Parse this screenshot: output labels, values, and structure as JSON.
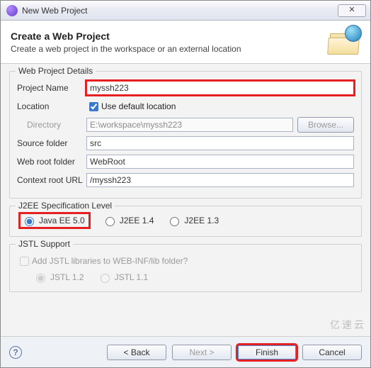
{
  "title": "New Web Project",
  "close": "✕",
  "header": {
    "heading": "Create a Web Project",
    "sub": "Create a web project in the workspace or an external location"
  },
  "details": {
    "group_title": "Web Project Details",
    "project_name_label": "Project Name",
    "project_name_value": "myssh223",
    "location_label": "Location",
    "use_default_label": "Use default location",
    "directory_label": "Directory",
    "directory_value": "E:\\workspace\\myssh223",
    "browse_label": "Browse...",
    "source_folder_label": "Source folder",
    "source_folder_value": "src",
    "web_root_label": "Web root folder",
    "web_root_value": "WebRoot",
    "context_root_label": "Context root URL",
    "context_root_value": "/myssh223"
  },
  "j2ee": {
    "group_title": "J2EE Specification Level",
    "opt1": "Java EE 5.0",
    "opt2": "J2EE 1.4",
    "opt3": "J2EE 1.3"
  },
  "jstl": {
    "group_title": "JSTL Support",
    "add_label": "Add JSTL libraries to WEB-INF/lib folder?",
    "opt1": "JSTL 1.2",
    "opt2": "JSTL 1.1"
  },
  "buttons": {
    "back": "< Back",
    "next": "Next >",
    "finish": "Finish",
    "cancel": "Cancel"
  },
  "watermark": "亿速云"
}
